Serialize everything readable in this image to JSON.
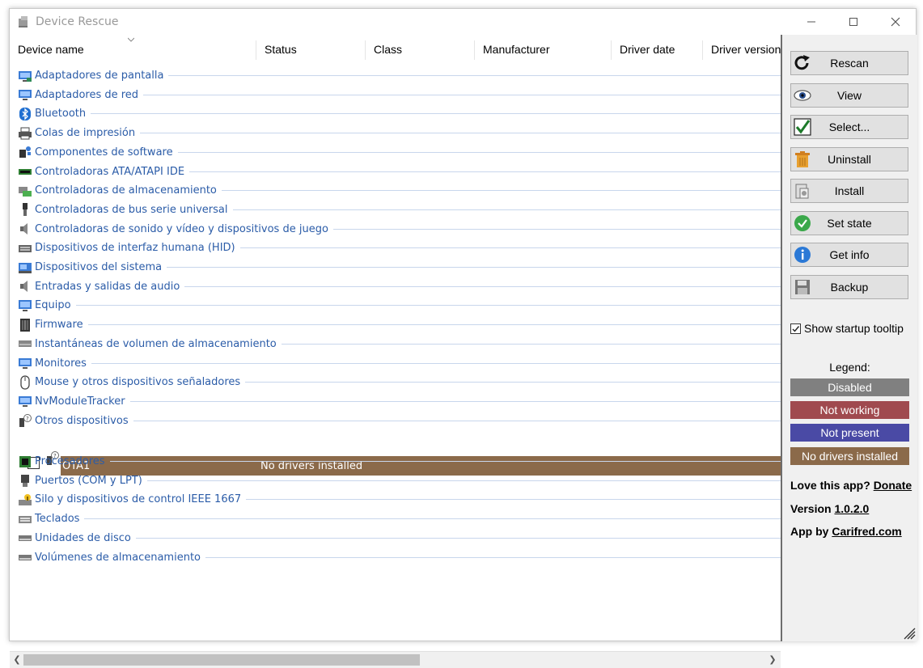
{
  "window": {
    "title": "Device Rescue"
  },
  "columns": [
    "Device name",
    "Status",
    "Class",
    "Manufacturer",
    "Driver date",
    "Driver version"
  ],
  "groups": [
    {
      "label": "Adaptadores de pantalla",
      "icon": "display-adapter-icon"
    },
    {
      "label": "Adaptadores de red",
      "icon": "network-adapter-icon"
    },
    {
      "label": "Bluetooth",
      "icon": "bluetooth-icon"
    },
    {
      "label": "Colas de impresión",
      "icon": "printer-icon"
    },
    {
      "label": "Componentes de software",
      "icon": "software-component-icon"
    },
    {
      "label": "Controladoras ATA/ATAPI IDE",
      "icon": "ide-controller-icon"
    },
    {
      "label": "Controladoras de almacenamiento",
      "icon": "storage-controller-icon"
    },
    {
      "label": "Controladoras de bus serie universal",
      "icon": "usb-icon"
    },
    {
      "label": "Controladoras de sonido y vídeo y dispositivos de juego",
      "icon": "speaker-icon"
    },
    {
      "label": "Dispositivos de interfaz humana (HID)",
      "icon": "hid-icon"
    },
    {
      "label": "Dispositivos del sistema",
      "icon": "system-device-icon"
    },
    {
      "label": "Entradas y salidas de audio",
      "icon": "audio-io-icon"
    },
    {
      "label": "Equipo",
      "icon": "computer-icon"
    },
    {
      "label": "Firmware",
      "icon": "firmware-icon"
    },
    {
      "label": "Instantáneas de volumen de almacenamiento",
      "icon": "volume-shadow-icon"
    },
    {
      "label": "Monitores",
      "icon": "monitor-icon"
    },
    {
      "label": "Mouse y otros dispositivos señaladores",
      "icon": "mouse-icon"
    },
    {
      "label": "NvModuleTracker",
      "icon": "nv-module-icon"
    },
    {
      "label": "Otros dispositivos",
      "icon": "unknown-device-icon"
    }
  ],
  "groups_after": [
    {
      "label": "Procesadores",
      "icon": "processor-icon"
    },
    {
      "label": "Puertos (COM y LPT)",
      "icon": "port-icon"
    },
    {
      "label": "Silo y dispositivos de control IEEE 1667",
      "icon": "silo-icon"
    },
    {
      "label": "Teclados",
      "icon": "keyboard-icon"
    },
    {
      "label": "Unidades de disco",
      "icon": "disk-drive-icon"
    },
    {
      "label": "Volúmenes de almacenamiento",
      "icon": "storage-volume-icon"
    }
  ],
  "selected_device": {
    "name": "OTA1",
    "status": "No drivers installed",
    "checked": false,
    "color": "#8b6a4a"
  },
  "buttons": [
    {
      "label": "Rescan",
      "icon": "rescan-icon"
    },
    {
      "label": "View",
      "icon": "eye-icon"
    },
    {
      "label": "Select...",
      "icon": "checkmark-icon"
    },
    {
      "label": "Uninstall",
      "icon": "trash-icon"
    },
    {
      "label": "Install",
      "icon": "install-icon"
    },
    {
      "label": "Set state",
      "icon": "set-state-icon"
    },
    {
      "label": "Get info",
      "icon": "info-icon"
    },
    {
      "label": "Backup",
      "icon": "floppy-icon"
    }
  ],
  "startup_tooltip": {
    "label": "Show startup tooltip",
    "checked": true
  },
  "legend": {
    "title": "Legend:",
    "items": [
      {
        "label": "Disabled",
        "color": "#808080"
      },
      {
        "label": "Not working",
        "color": "#a04a4f"
      },
      {
        "label": "Not present",
        "color": "#4a4aa5"
      },
      {
        "label": "No drivers installed",
        "color": "#8b6a4a"
      }
    ]
  },
  "footer": {
    "love_prefix": "Love this app? ",
    "donate": "Donate",
    "version_prefix": "Version ",
    "version": "1.0.2.0",
    "by_prefix": "App by ",
    "by_link": "Carifred.com"
  }
}
